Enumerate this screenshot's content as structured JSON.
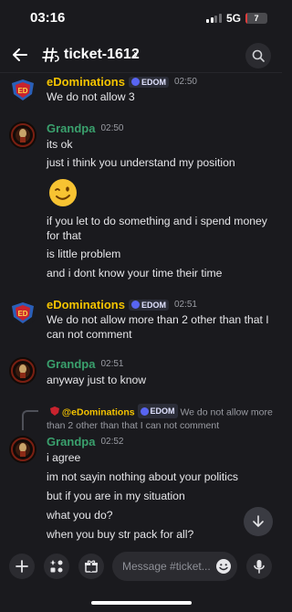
{
  "status_bar": {
    "time": "03:16",
    "network": "5G",
    "battery": "7",
    "battery_level": 0.07
  },
  "header": {
    "channel": "ticket-1612",
    "chevron": "›"
  },
  "tag_label": "EDOM",
  "messages": [
    {
      "author": "eDominations",
      "time": "02:50",
      "lines": [
        "We do not allow 3"
      ]
    },
    {
      "author": "Grandpa",
      "time": "02:50",
      "lines": [
        "its ok",
        "just i think you understand my position"
      ],
      "emoji": "winking-face",
      "lines_after": [
        "if you let to do something and i spend money for that",
        "is little problem",
        "and i dont know your time their time"
      ]
    },
    {
      "author": "eDominations",
      "time": "02:51",
      "lines": [
        "We do not allow more than 2 other than that I can not comment"
      ]
    },
    {
      "author": "Grandpa",
      "time": "02:51",
      "lines": [
        "anyway just to know"
      ]
    },
    {
      "reply": {
        "mention": "@eDominations",
        "text": "We do not allow more than 2 other than that I can not comment"
      },
      "author": "Grandpa",
      "time": "02:52",
      "lines": [
        "i agree",
        "im not sayin nothing about your politics",
        "but if you are in my situation",
        "what you do?",
        "when you buy str pack for all?"
      ]
    }
  ],
  "composer": {
    "placeholder": "Message #ticket..."
  },
  "colors": {
    "bg": "#1a1a1e",
    "edom_name": "#f5c400",
    "grandpa_name": "#3aa06d",
    "tag": "#5865f2"
  },
  "icons": [
    "back-arrow-icon",
    "channel-thread-icon",
    "search-icon",
    "scroll-down-icon",
    "plus-icon",
    "apps-icon",
    "gift-icon",
    "emoji-icon",
    "mic-icon"
  ]
}
